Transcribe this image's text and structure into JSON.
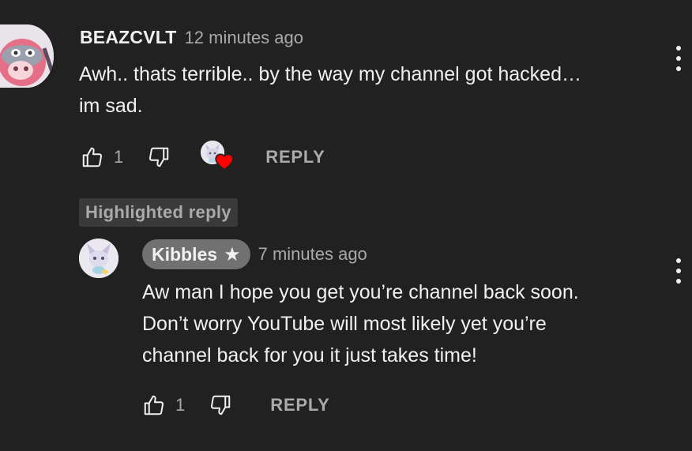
{
  "comment": {
    "author": "BEAZCVLT",
    "time": "12 minutes ago",
    "text": "Awh.. thats terrible.. by the way my channel got hacked…\nim sad.",
    "likes": "1",
    "reply_label": "REPLY",
    "avatar_icon": "user-avatar-icon",
    "creator_heart_icon": "creator-heart-icon"
  },
  "highlighted_badge": "Highlighted reply",
  "reply": {
    "author": "Kibbles",
    "author_star": "★",
    "time": "7 minutes ago",
    "text": "Aw man I hope you get you’re channel back soon.\nDon’t worry YouTube will most likely yet you’re\nchannel back for you it just takes time!",
    "likes": "1",
    "reply_label": "REPLY",
    "avatar_icon": "creator-avatar-icon"
  },
  "colors": {
    "background": "#212121",
    "text_primary": "#f1f1f1",
    "text_secondary": "#aaaaaa",
    "heart": "#ff0000",
    "creator_pill": "#717171"
  }
}
